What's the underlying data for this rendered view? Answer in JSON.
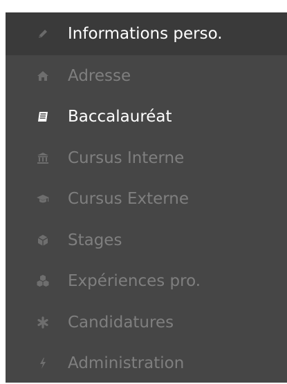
{
  "menu": {
    "items": [
      {
        "label": "Informations perso.",
        "icon": "pencil-icon",
        "active": true
      },
      {
        "label": "Adresse",
        "icon": "home-icon",
        "active": false
      },
      {
        "label": "Baccalauréat",
        "icon": "book-icon",
        "active": true
      },
      {
        "label": "Cursus Interne",
        "icon": "bank-icon",
        "active": false
      },
      {
        "label": "Cursus Externe",
        "icon": "graduation-cap-icon",
        "active": false
      },
      {
        "label": "Stages",
        "icon": "cube-icon",
        "active": false
      },
      {
        "label": "Expériences pro.",
        "icon": "cubes-icon",
        "active": false
      },
      {
        "label": "Candidatures",
        "icon": "asterisk-icon",
        "active": false
      },
      {
        "label": "Administration",
        "icon": "bolt-icon",
        "active": false
      }
    ]
  },
  "colors": {
    "background": "#464646",
    "first_row_background": "#3a3a3a",
    "active_text": "#ffffff",
    "inactive_text": "#7f7f7f",
    "icon_inactive": "#6e6e6e",
    "icon_active": "#ffffff"
  }
}
